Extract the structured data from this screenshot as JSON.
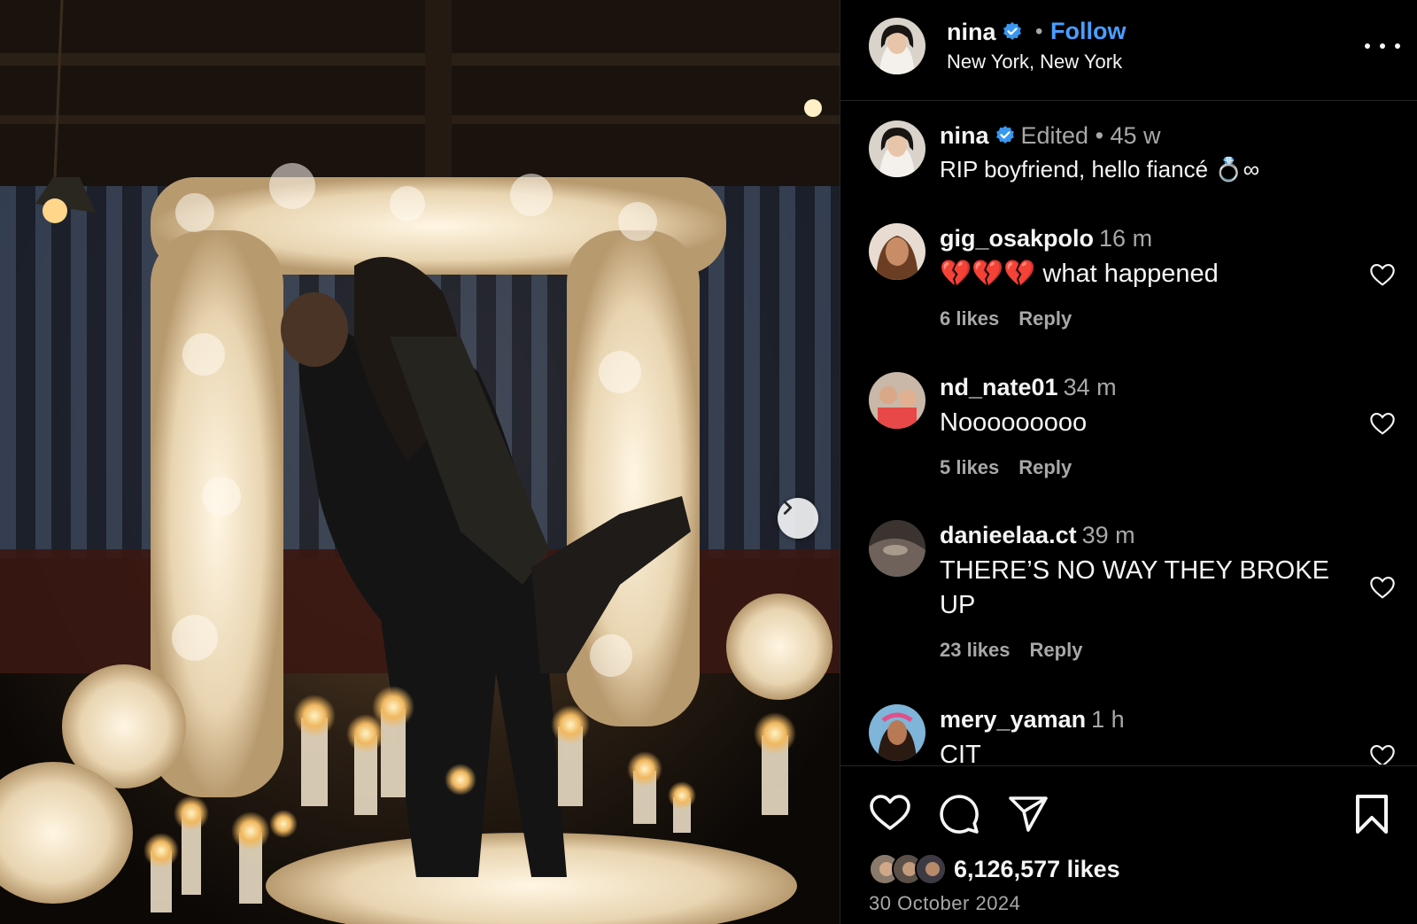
{
  "post": {
    "author": "nina",
    "follow_label": "Follow",
    "separator": "•",
    "location": "New York, New York",
    "caption": {
      "user": "nina",
      "meta": "Edited •  45 w",
      "text": "RIP boyfriend, hello fiancé 💍∞"
    },
    "likes": "6,126,577 likes",
    "date": "30 October 2024"
  },
  "comments": [
    {
      "user": "gig_osakpolo",
      "time": "16 m",
      "text": "💔💔💔 what happened",
      "likes": "6 likes",
      "reply": "Reply"
    },
    {
      "user": "nd_nate01",
      "time": "34 m",
      "text": "Nooooooooo",
      "likes": "5 likes",
      "reply": "Reply"
    },
    {
      "user": "danieelaa.ct",
      "time": "39 m",
      "text": "THERE’S NO WAY THEY BROKE UP",
      "likes": "23 likes",
      "reply": "Reply"
    },
    {
      "user": "mery_yaman",
      "time": "1 h",
      "text": "CIT",
      "likes": "",
      "reply": ""
    }
  ],
  "icons": {
    "verified": "verified-badge-icon",
    "more": "more-options-icon",
    "next": "chevron-right-icon",
    "like": "heart-icon",
    "comment": "comment-icon",
    "share": "share-icon",
    "save": "bookmark-icon"
  },
  "colors": {
    "background": "#000000",
    "link": "#4a9eff",
    "verified": "#3897f0",
    "muted": "#a8a8a8",
    "heartbreak": "#e0245e"
  }
}
